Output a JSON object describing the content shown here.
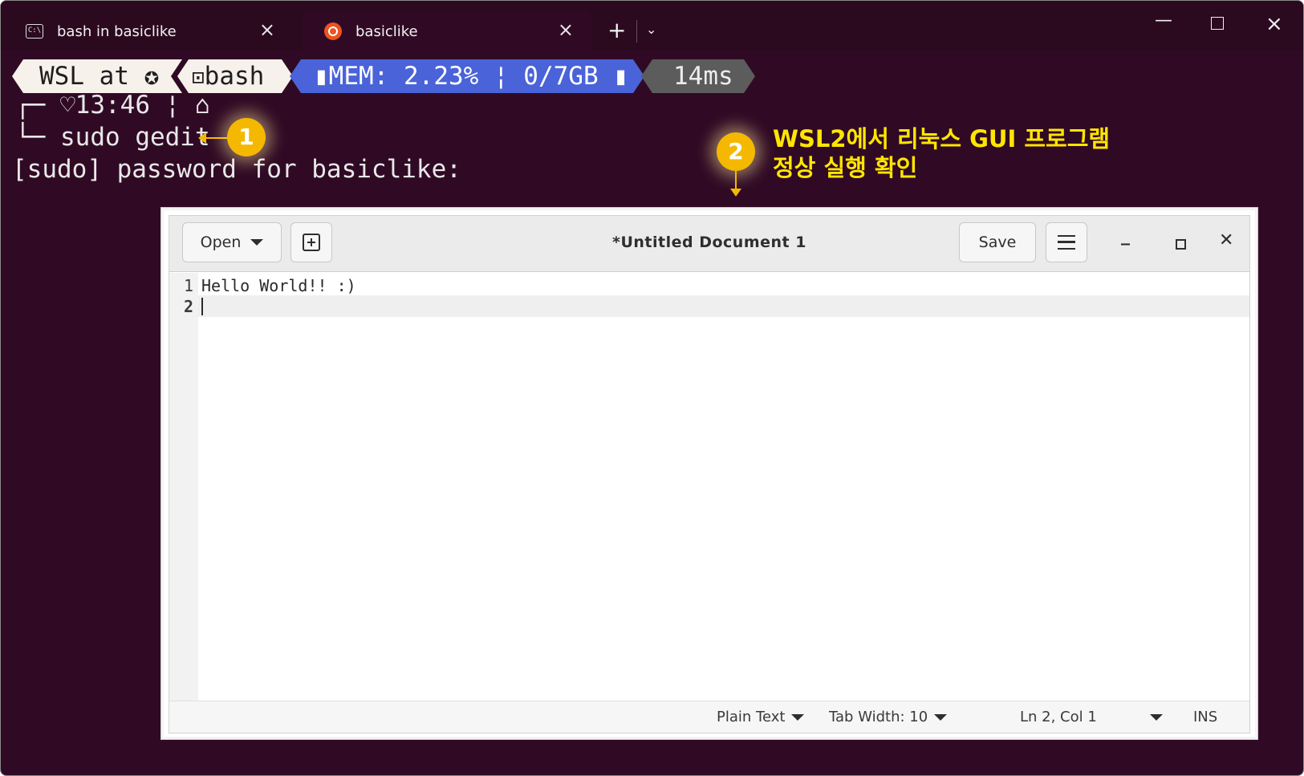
{
  "terminal": {
    "tabs": [
      {
        "label": "bash in basiclike",
        "icon": "cmd-icon"
      },
      {
        "label": "basiclike",
        "icon": "ubuntu-icon"
      }
    ],
    "new_tab": "+",
    "prompt": {
      "wsl": "WSL at",
      "shell": "bash",
      "mem": "MEM: 2.23% ¦ 0/7GB",
      "duration": "14ms"
    },
    "lines": {
      "clock": "13:46 ¦",
      "command": "sudo gedit",
      "sudo_prompt": "[sudo] password for basiclike:"
    },
    "colors": {
      "background": "#300a24",
      "mem_segment": "#4a63d8"
    }
  },
  "annotations": {
    "badge1": "1",
    "badge2": "2",
    "text_line1": "WSL2에서 리눅스 GUI 프로그램",
    "text_line2": "정상 실행 확인",
    "color": "#ffe600"
  },
  "gedit": {
    "open_label": "Open",
    "title": "*Untitled Document 1",
    "save_label": "Save",
    "lines": [
      {
        "number": "1",
        "text": "Hello World!! :)"
      },
      {
        "number": "2",
        "text": ""
      }
    ],
    "status": {
      "language": "Plain Text",
      "tab_width": "Tab Width: 10",
      "position": "Ln 2, Col 1",
      "mode": "INS"
    }
  }
}
